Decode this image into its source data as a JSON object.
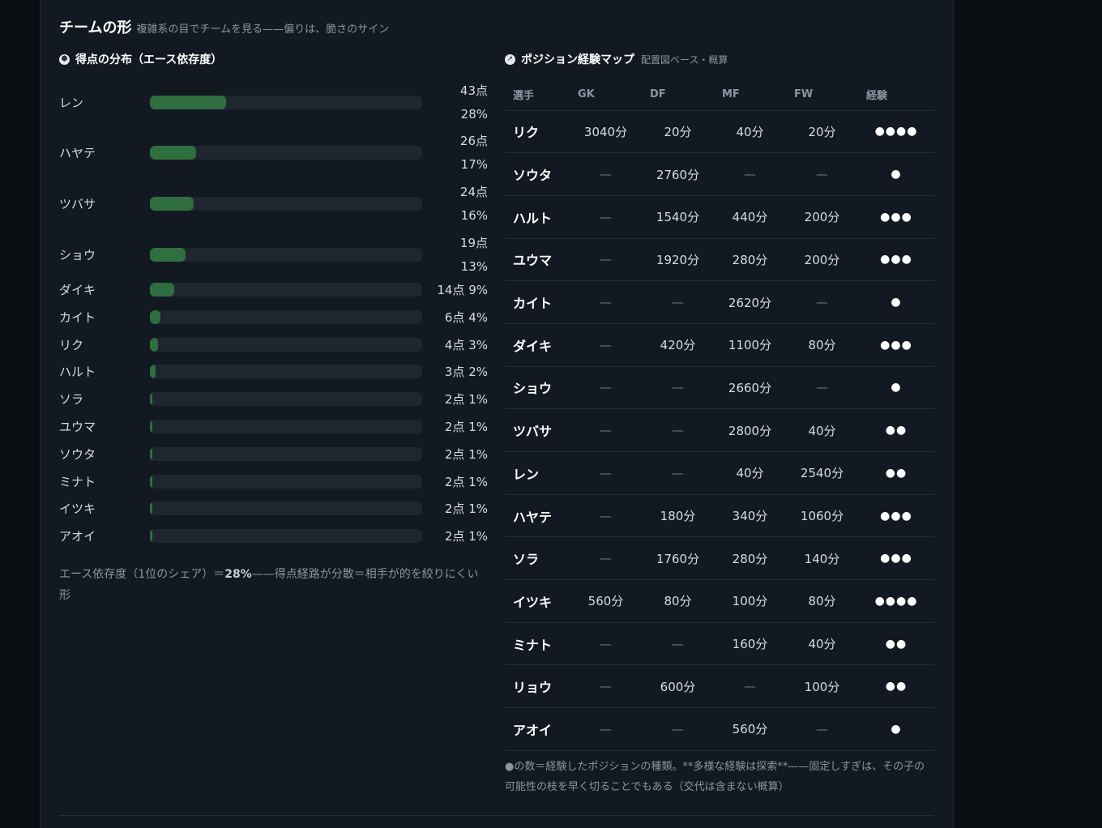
{
  "header": {
    "title": "チームの形",
    "subtitle": "複雑系の目でチームを見る——偏りは、脆さのサイン"
  },
  "score_section": {
    "title": "得点の分布（エース依存度）",
    "note_prefix": "エース依存度（1位のシェア）＝",
    "note_value": "28%",
    "note_suffix": "——得点経路が分散＝相手が的を絞りにくい形",
    "players": [
      {
        "name": "レン",
        "points": "43点",
        "share": "28%",
        "fraction": 0.28
      },
      {
        "name": "ハヤテ",
        "points": "26点",
        "share": "17%",
        "fraction": 0.17
      },
      {
        "name": "ツバサ",
        "points": "24点",
        "share": "16%",
        "fraction": 0.16
      },
      {
        "name": "ショウ",
        "points": "19点",
        "share": "13%",
        "fraction": 0.13
      },
      {
        "name": "ダイキ",
        "points": "14点",
        "share": "9%",
        "fraction": 0.09
      },
      {
        "name": "カイト",
        "points": "6点",
        "share": "4%",
        "fraction": 0.04
      },
      {
        "name": "リク",
        "points": "4点",
        "share": "3%",
        "fraction": 0.03
      },
      {
        "name": "ハルト",
        "points": "3点",
        "share": "2%",
        "fraction": 0.02
      },
      {
        "name": "ソラ",
        "points": "2点",
        "share": "1%",
        "fraction": 0.01
      },
      {
        "name": "ユウマ",
        "points": "2点",
        "share": "1%",
        "fraction": 0.01
      },
      {
        "name": "ソウタ",
        "points": "2点",
        "share": "1%",
        "fraction": 0.01
      },
      {
        "name": "ミナト",
        "points": "2点",
        "share": "1%",
        "fraction": 0.01
      },
      {
        "name": "イツキ",
        "points": "2点",
        "share": "1%",
        "fraction": 0.01
      },
      {
        "name": "アオイ",
        "points": "2点",
        "share": "1%",
        "fraction": 0.01
      }
    ]
  },
  "position_section": {
    "title": "ポジション経験マップ",
    "subtitle": "配置図ベース・概算",
    "columns": [
      "選手",
      "GK",
      "DF",
      "MF",
      "FW",
      "経験"
    ],
    "rows": [
      {
        "name": "リク",
        "gk": "3040分",
        "df": "20分",
        "mf": "40分",
        "fw": "20分",
        "exp": "●●●●"
      },
      {
        "name": "ソウタ",
        "gk": "—",
        "df": "2760分",
        "mf": "—",
        "fw": "—",
        "exp": "●"
      },
      {
        "name": "ハルト",
        "gk": "—",
        "df": "1540分",
        "mf": "440分",
        "fw": "200分",
        "exp": "●●●"
      },
      {
        "name": "ユウマ",
        "gk": "—",
        "df": "1920分",
        "mf": "280分",
        "fw": "200分",
        "exp": "●●●"
      },
      {
        "name": "カイト",
        "gk": "—",
        "df": "—",
        "mf": "2620分",
        "fw": "—",
        "exp": "●"
      },
      {
        "name": "ダイキ",
        "gk": "—",
        "df": "420分",
        "mf": "1100分",
        "fw": "80分",
        "exp": "●●●"
      },
      {
        "name": "ショウ",
        "gk": "—",
        "df": "—",
        "mf": "2660分",
        "fw": "—",
        "exp": "●"
      },
      {
        "name": "ツバサ",
        "gk": "—",
        "df": "—",
        "mf": "2800分",
        "fw": "40分",
        "exp": "●●"
      },
      {
        "name": "レン",
        "gk": "—",
        "df": "—",
        "mf": "40分",
        "fw": "2540分",
        "exp": "●●"
      },
      {
        "name": "ハヤテ",
        "gk": "—",
        "df": "180分",
        "mf": "340分",
        "fw": "1060分",
        "exp": "●●●"
      },
      {
        "name": "ソラ",
        "gk": "—",
        "df": "1760分",
        "mf": "280分",
        "fw": "140分",
        "exp": "●●●"
      },
      {
        "name": "イツキ",
        "gk": "560分",
        "df": "80分",
        "mf": "100分",
        "fw": "80分",
        "exp": "●●●●"
      },
      {
        "name": "ミナト",
        "gk": "—",
        "df": "—",
        "mf": "160分",
        "fw": "40分",
        "exp": "●●"
      },
      {
        "name": "リョウ",
        "gk": "—",
        "df": "600分",
        "mf": "—",
        "fw": "100分",
        "exp": "●●"
      },
      {
        "name": "アオイ",
        "gk": "—",
        "df": "—",
        "mf": "560分",
        "fw": "—",
        "exp": "●"
      }
    ],
    "note": "●の数＝経験したポジションの種類。**多様な経験は探索**——固定しすぎは、その子の可能性の枝を早く切ることでもある（交代は含まない概算）"
  },
  "icons": {
    "score_section_icon": "soccer-ball-icon",
    "position_section_icon": "compass-icon"
  },
  "colors": {
    "bar_fill": "#2f6f3f",
    "bar_track": "#1f2630",
    "background": "#0b0e13",
    "card": "#131922"
  }
}
